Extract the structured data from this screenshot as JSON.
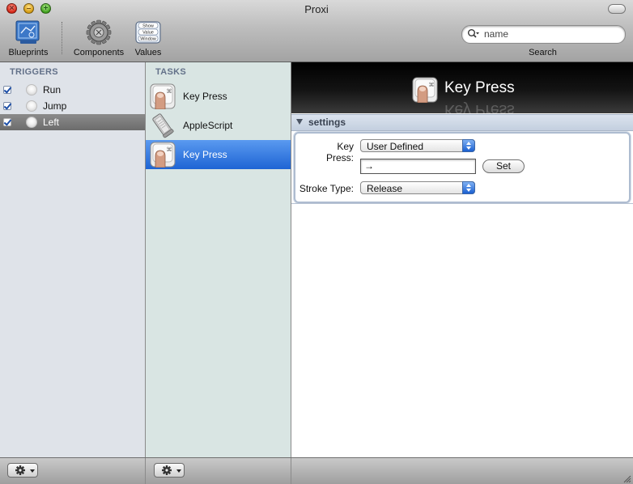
{
  "window": {
    "title": "Proxi"
  },
  "toolbar": {
    "items": [
      {
        "label": "Blueprints",
        "icon": "blueprints-icon"
      },
      {
        "label": "Components",
        "icon": "gear-cog-icon"
      },
      {
        "label": "Values",
        "icon": "show-value-window-icon",
        "icon_text": [
          "Show",
          "Value",
          "Window"
        ]
      }
    ],
    "search": {
      "placeholder": "name",
      "label": "Search"
    }
  },
  "triggers": {
    "heading": "TRIGGERS",
    "items": [
      {
        "label": "Run",
        "checked": true,
        "selected": false
      },
      {
        "label": "Jump",
        "checked": true,
        "selected": false
      },
      {
        "label": "Left",
        "checked": true,
        "selected": true
      }
    ]
  },
  "tasks": {
    "heading": "TASKS",
    "items": [
      {
        "label": "Key Press",
        "icon": "key-press-icon",
        "selected": false
      },
      {
        "label": "AppleScript",
        "icon": "applescript-icon",
        "selected": false
      },
      {
        "label": "Key Press",
        "icon": "key-press-icon",
        "selected": true
      }
    ]
  },
  "detail": {
    "title": "Key Press",
    "settings_label": "settings",
    "fields": {
      "key_press_label": "Key Press:",
      "key_press_value": "User Defined",
      "key_value": "→",
      "set_button": "Set",
      "stroke_type_label": "Stroke Type:",
      "stroke_type_value": "Release"
    }
  },
  "colors": {
    "selection_blue": "#1e64d4",
    "trigger_selected": "#6c6c6c",
    "section_heading": "#637189"
  }
}
